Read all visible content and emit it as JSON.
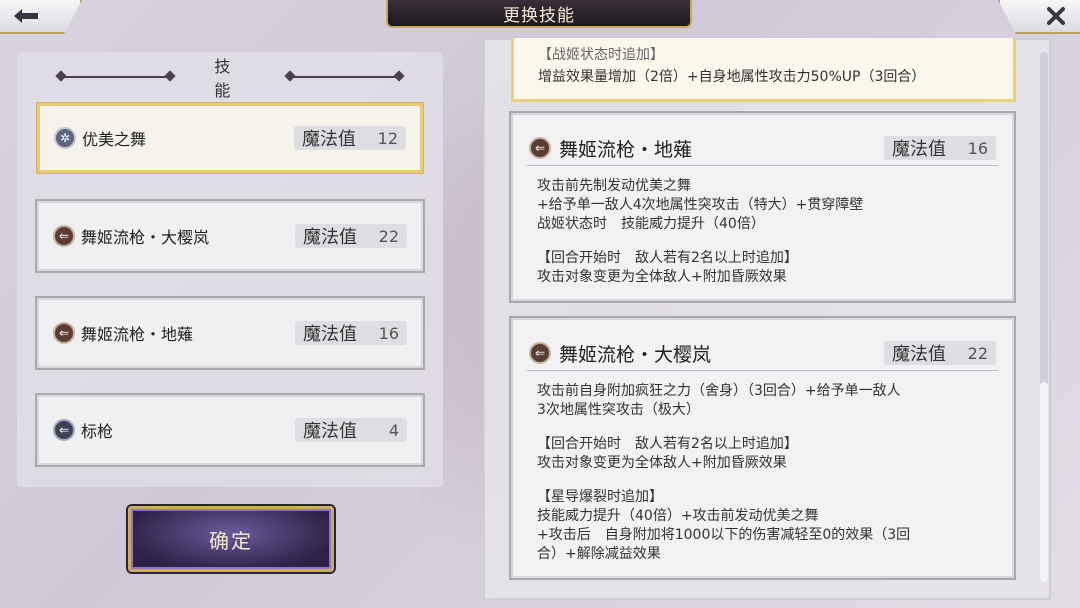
{
  "window": {
    "title": "更换技能"
  },
  "panel": {
    "header": "技能"
  },
  "mp_label": "魔法值",
  "skills": [
    {
      "name": "优美之舞",
      "mp": "12",
      "icon": "flower-icon",
      "selected": true
    },
    {
      "name": "舞姬流枪・大樱岚",
      "mp": "22",
      "icon": "arrow-icon",
      "selected": false
    },
    {
      "name": "舞姬流枪・地薙",
      "mp": "16",
      "icon": "arrow-icon",
      "selected": false
    },
    {
      "name": "标枪",
      "mp": "4",
      "icon": "spear-icon",
      "selected": false
    }
  ],
  "confirm_label": "确定",
  "details": {
    "top_partial": {
      "line1": "【战姬状态时追加】",
      "line2": "增益效果量增加（2倍）+自身地属性攻击力50%UP（3回合）"
    },
    "cards": [
      {
        "title": "舞姬流枪・地薙",
        "mp": "16",
        "lines": [
          "攻击前先制发动优美之舞",
          "+给予单一敌人4次地属性突攻击（特大）+贯穿障壁",
          "战姬状态时　技能威力提升（40倍）",
          "",
          "【回合开始时　敌人若有2名以上时追加】",
          "攻击对象变更为全体敌人+附加昏厥效果"
        ]
      },
      {
        "title": "舞姬流枪・大樱岚",
        "mp": "22",
        "lines": [
          "攻击前自身附加疯狂之力（舍身）（3回合）+给予单一敌人",
          "3次地属性突攻击（极大）",
          "",
          "【回合开始时　敌人若有2名以上时追加】",
          "攻击对象变更为全体敌人+附加昏厥效果",
          "",
          "【星导爆裂时追加】",
          "技能威力提升（40倍）+攻击前发动优美之舞",
          "+攻击后　自身附加将1000以下的伤害减轻至0的效果（3回",
          "合）+解除减益效果"
        ]
      }
    ]
  }
}
